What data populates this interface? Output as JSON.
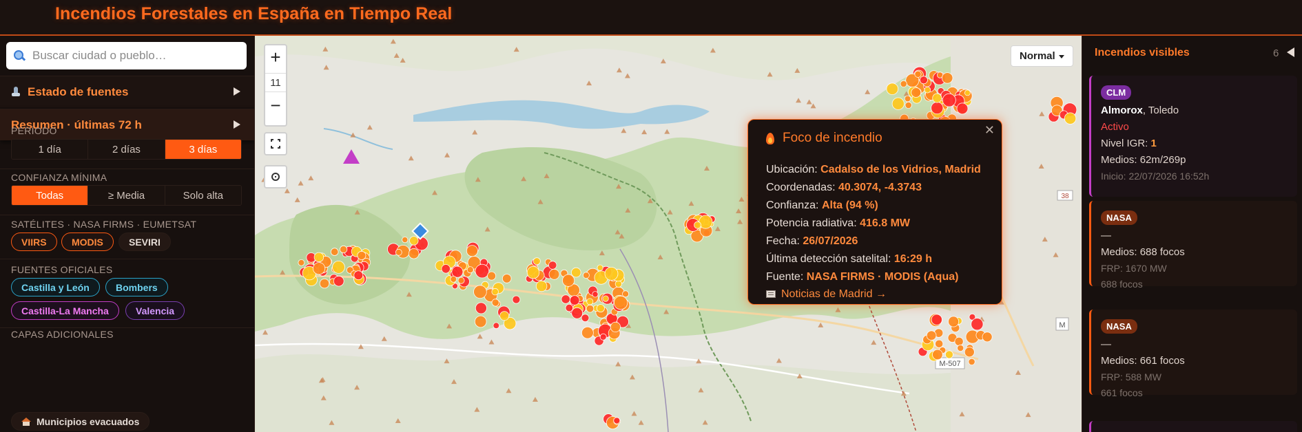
{
  "header": {
    "title": "Incendios Forestales en España en Tiempo Real"
  },
  "search": {
    "placeholder": "Buscar ciudad o pueblo…"
  },
  "sections": {
    "sources_status": "Estado de fuentes",
    "summary": "Resumen · últimas 72 h"
  },
  "period": {
    "label": "PERÍODO",
    "options": [
      "1 día",
      "2 días",
      "3 días"
    ],
    "selected": "3 días"
  },
  "confidence": {
    "label": "CONFIANZA MÍNIMA",
    "options": [
      "Todas",
      "≥ Media",
      "Solo alta"
    ],
    "selected": "Todas"
  },
  "satellites": {
    "label": "SATÉLITES · NASA FIRMS · EUMETSAT",
    "items": [
      "VIIRS",
      "MODIS",
      "SEVIRI"
    ]
  },
  "official": {
    "label": "FUENTES OFICIALES",
    "items": [
      "Castilla y León",
      "Bombers",
      "Castilla-La Mancha",
      "Valencia"
    ]
  },
  "extra": {
    "label": "CAPAS ADICIONALES",
    "items": [
      "Municipios evacuados"
    ]
  },
  "map": {
    "zoom_level": "11",
    "basemap": "Normal",
    "road_labels": [
      "38",
      "M-507",
      "M"
    ],
    "popup": {
      "title": "Foco de incendio",
      "location_label": "Ubicación:",
      "location": "Cadalso de los Vidrios, Madrid",
      "coords_label": "Coordenadas:",
      "coords": "40.3074, -4.3743",
      "confidence_label": "Confianza:",
      "confidence": "Alta (94 %)",
      "frp_label": "Potencia radiativa:",
      "frp": "416.8 MW",
      "date_label": "Fecha:",
      "date": "26/07/2026",
      "last_label": "Última detección satelital:",
      "last": "16:29 h",
      "source_label": "Fuente:",
      "source": "NASA FIRMS · MODIS (Aqua)",
      "news_link": "Noticias de Madrid →"
    }
  },
  "colors": {
    "accent": "#ff5a12",
    "fire_red": "#ff2a2a",
    "fire_orange": "#ff8a1e",
    "fire_yellow": "#ffc81e"
  },
  "right_panel": {
    "title": "Incendios visibles",
    "count": "6",
    "cards": [
      {
        "tag": "CLM",
        "town": "Almorox",
        "province": ", Toledo",
        "status": "Activo",
        "igr_label": "Nivel IGR: ",
        "igr": "1",
        "means": "Medios: 62m/269p",
        "start": "Inicio: 22/07/2026 16:52h"
      },
      {
        "tag": "NASA",
        "dash": "—",
        "means": "Medios: 688 focos",
        "frp": "FRP: 1670 MW",
        "count": "688 focos"
      },
      {
        "tag": "NASA",
        "dash": "—",
        "means": "Medios: 661 focos",
        "frp": "FRP: 588 MW",
        "count": "661 focos"
      }
    ]
  }
}
